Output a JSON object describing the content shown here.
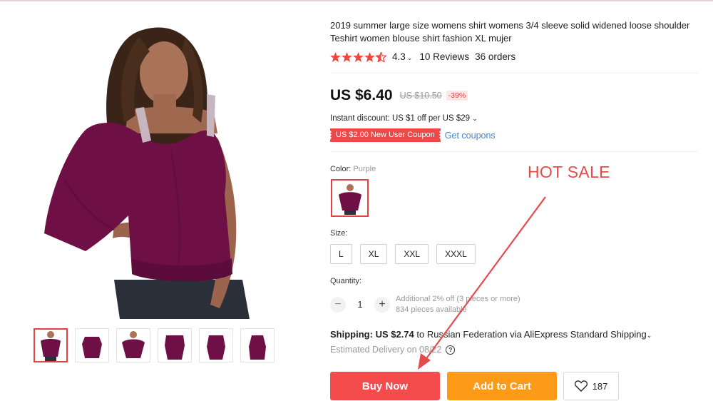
{
  "product": {
    "title": "2019 summer large size womens shirt womens 3/4 sleeve solid widened loose shoulder Teshirt women blouse shirt fashion XL mujer",
    "rating": "4.3",
    "reviews": "10 Reviews",
    "orders": "36 orders"
  },
  "price": {
    "current": "US $6.40",
    "original": "US $10.50",
    "discount": "-39%"
  },
  "promo": {
    "instant": "Instant discount: US $1 off per US $29",
    "coupon": "US $2.00 New User Coupon",
    "get_coupons": "Get coupons"
  },
  "color": {
    "label": "Color:",
    "value": "Purple"
  },
  "size": {
    "label": "Size:",
    "options": [
      "L",
      "XL",
      "XXL",
      "XXXL"
    ]
  },
  "quantity": {
    "label": "Quantity:",
    "value": "1",
    "note": "Additional 2% off (3 pieces or more)",
    "available": "834 pieces available"
  },
  "shipping": {
    "label": "Shipping:",
    "price": "US $2.74",
    "text": "to Russian Federation via AliExpress Standard Shipping",
    "delivery": "Estimated Delivery on 08/22"
  },
  "actions": {
    "buy_now": "Buy Now",
    "add_to_cart": "Add to Cart",
    "wishlist_count": "187"
  },
  "overlay": {
    "hot_sale": "HOT SALE"
  },
  "colors": {
    "accent_red": "#f44c4c",
    "accent_orange": "#fd9b19",
    "garment": "#6e1046",
    "link": "#3b86d1"
  }
}
